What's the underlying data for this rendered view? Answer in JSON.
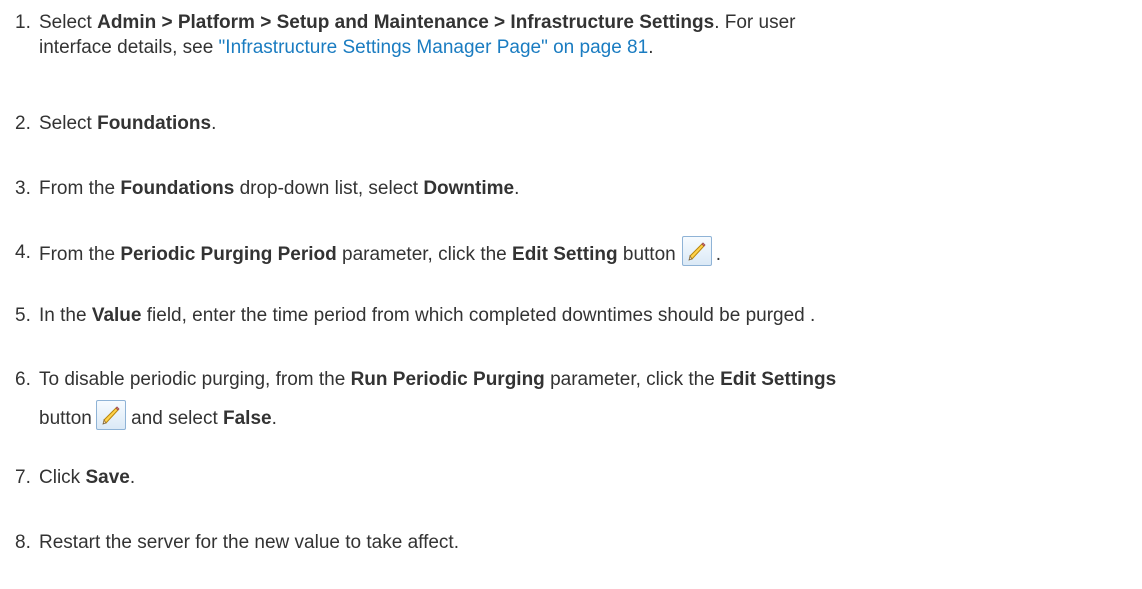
{
  "steps": [
    {
      "num": "1.",
      "t1": "Select ",
      "b1": "Admin > Platform > Setup and Maintenance > Infrastructure Settings",
      "t2": ". For user",
      "t3": "interface details, see ",
      "link": "\"Infrastructure Settings Manager Page\" on page 81",
      "t4": "."
    },
    {
      "num": "2.",
      "t1": "Select ",
      "b1": "Foundations",
      "t2": "."
    },
    {
      "num": "3.",
      "t1": "From the ",
      "b1": "Foundations",
      "t2": " drop-down list, select ",
      "b2": "Downtime",
      "t3": "."
    },
    {
      "num": "4.",
      "t1": "From the ",
      "b1": "Periodic Purging Period",
      "t2": " parameter, click the ",
      "b2": "Edit Setting",
      "t3": " button",
      "t4": "."
    },
    {
      "num": "5.",
      "t1": "In the ",
      "b1": "Value",
      "t2": " field, enter the time period from which completed downtimes should be purged ."
    },
    {
      "num": "6.",
      "t1": "To disable periodic purging, from the ",
      "b1": "Run Periodic Purging",
      "t2": " parameter, click the ",
      "b2": "Edit Settings",
      "t3": "button",
      "t4": " and select ",
      "b3": "False",
      "t5": "."
    },
    {
      "num": "7.",
      "t1": "Click ",
      "b1": "Save",
      "t2": "."
    },
    {
      "num": "8.",
      "t1": "Restart the server for the new value to take affect."
    }
  ],
  "icons": {
    "edit_button": "pencil-icon"
  },
  "colors": {
    "text": "#333333",
    "link": "#1a7cc1"
  }
}
